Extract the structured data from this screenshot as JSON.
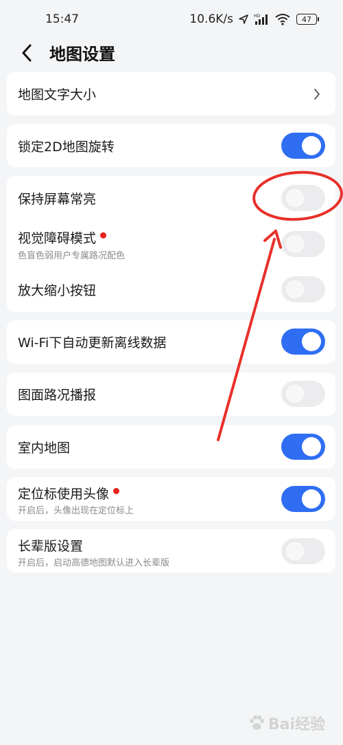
{
  "status_bar": {
    "time": "15:47",
    "speed": "10.6K/s",
    "battery": "47"
  },
  "header": {
    "title": "地图设置"
  },
  "settings": {
    "font_size": {
      "label": "地图文字大小"
    },
    "lock_2d": {
      "label": "锁定2D地图旋转",
      "on": true
    },
    "keep_screen_on": {
      "label": "保持屏幕常亮",
      "on": false
    },
    "visual_mode": {
      "label": "视觉障碍模式",
      "sub": "色盲色弱用户专属路况配色",
      "on": false
    },
    "zoom_buttons": {
      "label": "放大缩小按钮",
      "on": false
    },
    "wifi_update": {
      "label": "Wi-Fi下自动更新离线数据",
      "on": true
    },
    "traffic_broadcast": {
      "label": "图面路况播报",
      "on": false
    },
    "indoor_map": {
      "label": "室内地图",
      "on": true
    },
    "avatar_marker": {
      "label": "定位标使用头像",
      "sub": "开启后，头像出现在定位标上",
      "on": true
    },
    "elder_mode": {
      "label": "长辈版设置",
      "sub": "开启后，启动高德地图默认进入长辈版",
      "on": false
    }
  },
  "colors": {
    "accent": "#2f6ef2",
    "annotation": "#e8302a",
    "red_dot": "#e8221b"
  },
  "watermark": {
    "text": "Bai经验"
  }
}
